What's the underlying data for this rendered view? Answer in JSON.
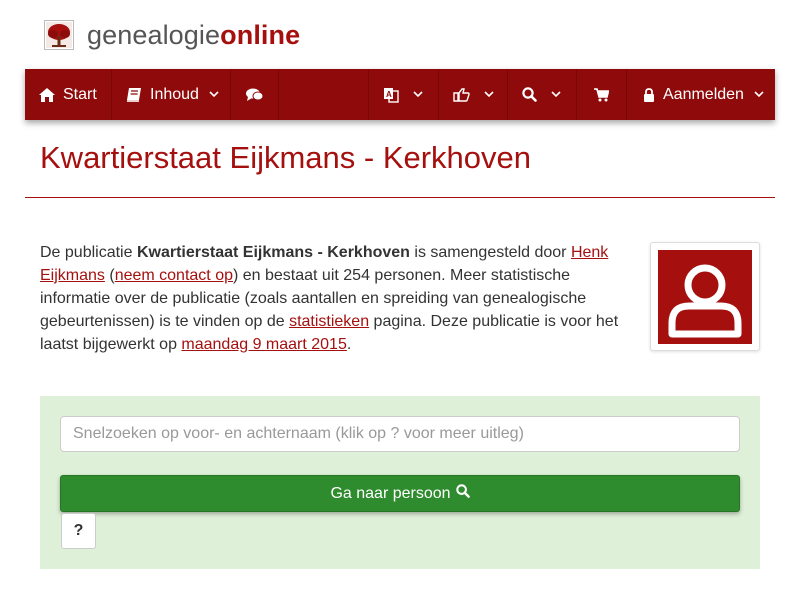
{
  "logo": {
    "text_regular": "genealogie",
    "text_strong": "online",
    "icon": "tree-icon"
  },
  "navbar": {
    "items": [
      {
        "label": "Start",
        "icon": "home-icon"
      },
      {
        "label": "Inhoud",
        "icon": "book-icon"
      },
      {
        "label": "",
        "icon": "comments-icon"
      },
      {
        "label": "",
        "icon": "translate-icon"
      },
      {
        "label": "",
        "icon": "share-icon"
      },
      {
        "label": "",
        "icon": "search-icon"
      },
      {
        "label": "",
        "icon": "cart-icon"
      },
      {
        "label": "Aanmelden",
        "icon": "lock-icon"
      }
    ]
  },
  "page": {
    "title": "Kwartierstaat Eijkmans - Kerkhoven"
  },
  "description": {
    "part1": "De publicatie ",
    "publication_name": "Kwartierstaat Eijkmans - Kerkhoven",
    "part2": " is samengesteld door ",
    "author_link": "Henk Eijkmans",
    "part3": " (",
    "contact_link": "neem contact op",
    "part4": ") en bestaat uit 254 personen. Meer statistische informatie over de publicatie (zoals aantallen en spreiding van genealogische gebeurtenissen) is te vinden op de ",
    "stats_link": "statistieken",
    "part5": " pagina. Deze publicatie is voor het laatst bijgewerkt op ",
    "date_link": "maandag 9 maart 2015",
    "part6": "."
  },
  "search": {
    "placeholder": "Snelzoeken op voor- en achternaam (klik op ? voor meer uitleg)",
    "value": "",
    "go_label": "Ga naar persoon",
    "help_label": "?"
  },
  "colors": {
    "brand": "#a5100f",
    "navbar": "#8f0a0a",
    "panel": "#dff0d8",
    "button": "#2e8b2e"
  }
}
